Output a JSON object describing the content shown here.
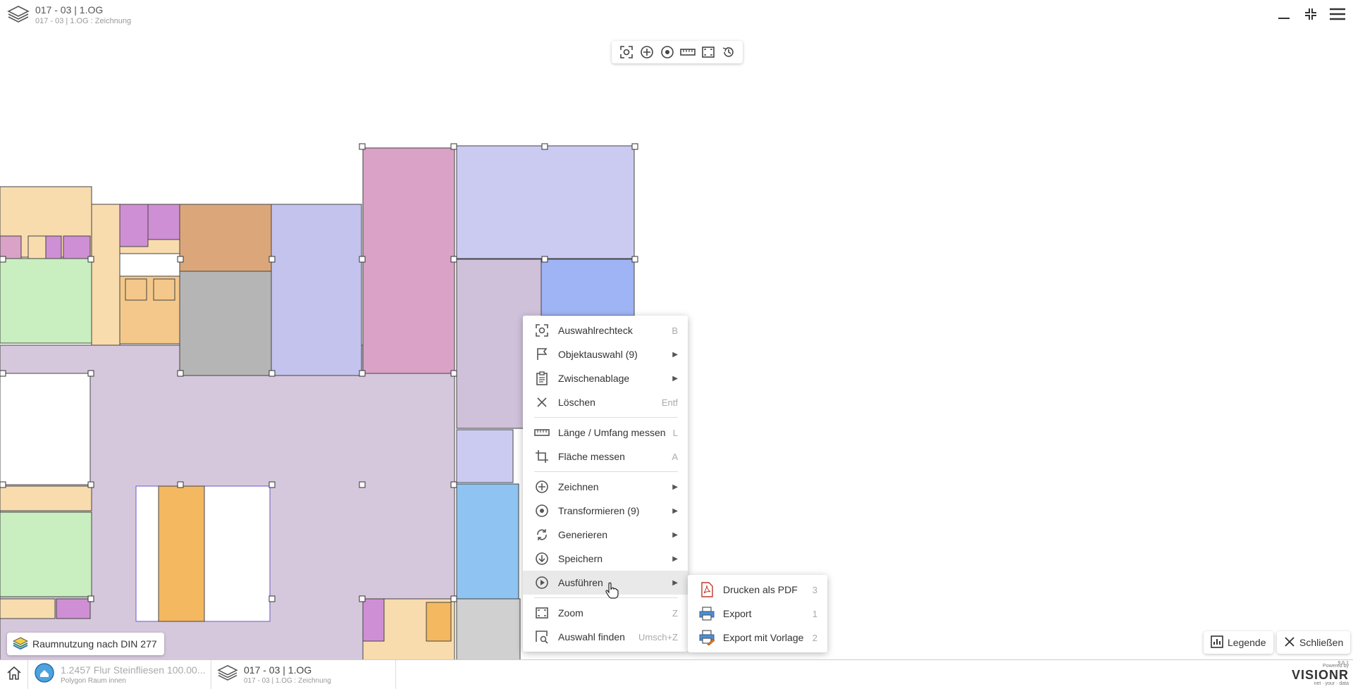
{
  "header": {
    "title": "017 - 03 | 1.OG",
    "subtitle": "017 - 03 | 1.OG : Zeichnung"
  },
  "context_menu": {
    "items": [
      {
        "label": "Auswahlrechteck",
        "shortcut": "B",
        "icon": "selection-rect-icon"
      },
      {
        "label": "Objektauswahl (9)",
        "submenu": true,
        "icon": "flag-icon"
      },
      {
        "label": "Zwischenablage",
        "submenu": true,
        "icon": "clipboard-icon"
      },
      {
        "label": "Löschen",
        "shortcut": "Entf",
        "icon": "close-icon"
      },
      {
        "label": "Länge / Umfang messen",
        "shortcut": "L",
        "icon": "ruler-icon"
      },
      {
        "label": "Fläche messen",
        "shortcut": "A",
        "icon": "crop-icon"
      },
      {
        "label": "Zeichnen",
        "submenu": true,
        "icon": "plus-circle-icon"
      },
      {
        "label": "Transformieren (9)",
        "submenu": true,
        "icon": "target-icon"
      },
      {
        "label": "Generieren",
        "submenu": true,
        "icon": "refresh-icon"
      },
      {
        "label": "Speichern",
        "submenu": true,
        "icon": "download-circle-icon"
      },
      {
        "label": "Ausführen",
        "submenu": true,
        "icon": "play-circle-icon",
        "active": true
      },
      {
        "label": "Zoom",
        "shortcut": "Z",
        "icon": "zoom-frame-icon"
      },
      {
        "label": "Auswahl finden",
        "shortcut": "Umsch+Z",
        "icon": "find-selection-icon"
      }
    ]
  },
  "submenu": {
    "items": [
      {
        "label": "Drucken als PDF",
        "shortcut": "3",
        "icon": "pdf-icon"
      },
      {
        "label": "Export",
        "shortcut": "1",
        "icon": "printer-icon"
      },
      {
        "label": "Export mit Vorlage",
        "shortcut": "2",
        "icon": "printer-template-icon"
      }
    ]
  },
  "layer_chip": {
    "label": "Raumnutzung nach DIN 277"
  },
  "buttons": {
    "legend": "Legende",
    "close": "Schließen"
  },
  "statusbar": {
    "item1": {
      "title": "1.2457 Flur Steinfliesen 100.00...",
      "sub": "Polygon Raum innen"
    },
    "item2": {
      "title": "017 - 03 | 1.OG",
      "sub": "017 - 03 | 1.OG : Zeichnung"
    }
  },
  "brand": {
    "powered": "Powered by",
    "name": "VISIONR",
    "tagline": "net · your · data",
    "version": "9.6.1"
  },
  "colors": {
    "lavender": "#d6c8dc",
    "orange": "#f4c88a",
    "peach": "#f8dcae",
    "green": "#c9efc0",
    "pink": "#d9a2c6",
    "magenta": "#cf8fd4",
    "periwinkle": "#cbcbf2",
    "blue": "#9fb4f5",
    "lightblue": "#8fc4f2",
    "gray": "#b5b5b5",
    "brown": "#dba77a"
  }
}
